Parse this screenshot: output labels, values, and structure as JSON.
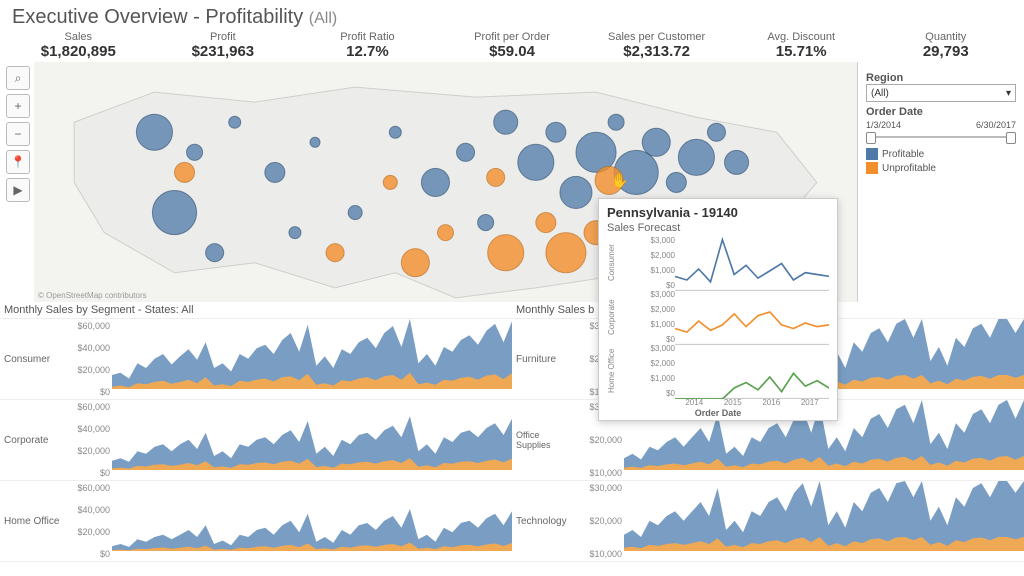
{
  "title_main": "Executive Overview - Profitability",
  "title_scope": "(All)",
  "kpis": [
    {
      "label": "Sales",
      "value": "$1,820,895"
    },
    {
      "label": "Profit",
      "value": "$231,963"
    },
    {
      "label": "Profit Ratio",
      "value": "12.7%"
    },
    {
      "label": "Profit per Order",
      "value": "$59.04"
    },
    {
      "label": "Sales per Customer",
      "value": "$2,313.72"
    },
    {
      "label": "Avg. Discount",
      "value": "15.71%"
    },
    {
      "label": "Quantity",
      "value": "29,793"
    }
  ],
  "map_attribution": "© OpenStreetMap contributors",
  "filters": {
    "region_label": "Region",
    "region_selected": "(All)",
    "date_label": "Order Date",
    "date_start": "1/3/2014",
    "date_end": "6/30/2017",
    "legend": [
      {
        "name": "Profitable",
        "color": "#4e79a7"
      },
      {
        "name": "Unprofitable",
        "color": "#f28e2b"
      }
    ]
  },
  "left_panel_title": "Monthly Sales by Segment - States: All",
  "right_panel_title": "Monthly Sales b",
  "segments": [
    "Consumer",
    "Corporate",
    "Home Office"
  ],
  "categories": [
    "Furniture",
    "Office Supplies",
    "Technology"
  ],
  "left_y_ticks": [
    "$60,000",
    "$40,000",
    "$20,000",
    "$0"
  ],
  "right_y_ticks": [
    "$30,000",
    "$20,000",
    "$10,000"
  ],
  "tooltip": {
    "header": "Pennsylvania - 19140",
    "sub": "Sales Forecast",
    "rows": [
      "Consumer",
      "Corporate",
      "Home Office"
    ],
    "y_ticks": [
      "$3,000",
      "$2,000",
      "$1,000",
      "$0"
    ],
    "x_ticks": [
      "2014",
      "2015",
      "2016",
      "2017"
    ],
    "x_label": "Order Date",
    "colors": [
      "#4e79a7",
      "#f28e2b",
      "#59a14f"
    ]
  },
  "chart_data": {
    "kpi_values": {
      "Sales": 1820895,
      "Profit": 231963,
      "Profit Ratio": 0.127,
      "Profit per Order": 59.04,
      "Sales per Customer": 2313.72,
      "Avg. Discount": 0.1571,
      "Quantity": 29793
    },
    "monthly_sales_by_segment": {
      "type": "area",
      "x_months": 48,
      "ylim": [
        0,
        60000
      ],
      "series": [
        {
          "name": "Consumer",
          "profitable": [
            12000,
            14000,
            9000,
            22000,
            18000,
            26000,
            30000,
            21000,
            28000,
            34000,
            25000,
            40000,
            18000,
            22000,
            15000,
            30000,
            26000,
            35000,
            38000,
            30000,
            42000,
            48000,
            32000,
            55000,
            20000,
            28000,
            18000,
            34000,
            30000,
            40000,
            44000,
            35000,
            48000,
            54000,
            36000,
            60000,
            22000,
            30000,
            20000,
            36000,
            32000,
            42000,
            46000,
            38000,
            50000,
            56000,
            40000,
            58000
          ],
          "unprofitable": [
            2000,
            3000,
            1500,
            5000,
            4000,
            6000,
            7000,
            4500,
            6000,
            8000,
            5000,
            10000,
            3000,
            4000,
            2500,
            7000,
            6000,
            8000,
            9000,
            6500,
            10000,
            11000,
            7500,
            13000,
            3500,
            5000,
            3000,
            7500,
            6500,
            9000,
            10000,
            7500,
            11000,
            12000,
            8000,
            14000,
            4000,
            5500,
            3500,
            8000,
            7000,
            9500,
            10500,
            8000,
            11500,
            12500,
            8500,
            13500
          ]
        },
        {
          "name": "Corporate",
          "profitable": [
            8000,
            10000,
            7000,
            16000,
            14000,
            20000,
            22000,
            16000,
            22000,
            26000,
            18000,
            32000,
            12000,
            16000,
            10000,
            22000,
            20000,
            26000,
            28000,
            22000,
            30000,
            34000,
            24000,
            42000,
            14000,
            20000,
            12000,
            26000,
            22000,
            30000,
            32000,
            26000,
            34000,
            38000,
            28000,
            46000,
            16000,
            22000,
            14000,
            28000,
            24000,
            32000,
            34000,
            28000,
            36000,
            40000,
            30000,
            44000
          ],
          "unprofitable": [
            1500,
            2000,
            1200,
            3500,
            3000,
            4500,
            5000,
            3500,
            4500,
            6000,
            4000,
            7500,
            2200,
            3000,
            1800,
            5000,
            4500,
            6000,
            6500,
            5000,
            7000,
            8000,
            5500,
            9500,
            2500,
            3500,
            2000,
            5500,
            5000,
            6500,
            7000,
            5500,
            7500,
            8500,
            6000,
            10000,
            2800,
            4000,
            2300,
            6000,
            5500,
            7000,
            7500,
            6000,
            8000,
            9000,
            6500,
            9800
          ]
        },
        {
          "name": "Home Office",
          "profitable": [
            4000,
            6000,
            3500,
            10000,
            8000,
            12000,
            14000,
            10000,
            14000,
            18000,
            12000,
            22000,
            6000,
            9000,
            5000,
            14000,
            12000,
            18000,
            20000,
            14000,
            22000,
            26000,
            16000,
            32000,
            8000,
            12000,
            7000,
            18000,
            14000,
            22000,
            24000,
            18000,
            26000,
            30000,
            20000,
            36000,
            10000,
            14000,
            8000,
            20000,
            16000,
            24000,
            26000,
            20000,
            28000,
            32000,
            22000,
            34000
          ],
          "unprofitable": [
            800,
            1200,
            700,
            2000,
            1600,
            2500,
            3000,
            2000,
            2800,
            3600,
            2400,
            4500,
            1200,
            1800,
            1000,
            2800,
            2400,
            3600,
            4000,
            2800,
            4400,
            5200,
            3200,
            6400,
            1600,
            2400,
            1400,
            3600,
            2800,
            4400,
            4800,
            3600,
            5200,
            6000,
            4000,
            7200,
            2000,
            2800,
            1600,
            4000,
            3200,
            4800,
            5200,
            4000,
            5600,
            6400,
            4400,
            6800
          ]
        }
      ]
    },
    "monthly_sales_by_category": {
      "type": "area",
      "x_months": 48,
      "ylim": [
        0,
        30000
      ],
      "series": [
        {
          "name": "Furniture",
          "profitable": [
            6000,
            8000,
            5000,
            12000,
            10000,
            14000,
            16000,
            12000,
            16000,
            20000,
            14000,
            26000,
            8000,
            12000,
            7000,
            16000,
            14000,
            20000,
            22000,
            16000,
            24000,
            28000,
            18000,
            30000,
            10000,
            16000,
            9000,
            20000,
            16000,
            24000,
            26000,
            20000,
            28000,
            30000,
            22000,
            30000,
            12000,
            18000,
            10000,
            22000,
            18000,
            26000,
            28000,
            22000,
            30000,
            30000,
            24000,
            30000
          ],
          "unprofitable": [
            1200,
            1600,
            1000,
            2400,
            2000,
            2800,
            3200,
            2400,
            3200,
            4000,
            2800,
            5200,
            1600,
            2400,
            1400,
            3200,
            2800,
            4000,
            4400,
            3200,
            4800,
            5600,
            3600,
            6000,
            2000,
            3200,
            1800,
            4000,
            3200,
            4800,
            5200,
            4000,
            5600,
            6000,
            4400,
            6000,
            2400,
            3600,
            2000,
            4400,
            3600,
            5200,
            5600,
            4400,
            6000,
            6000,
            4800,
            6000
          ]
        },
        {
          "name": "Office Supplies",
          "profitable": [
            5000,
            7000,
            4500,
            10000,
            8500,
            12000,
            14000,
            10000,
            14000,
            18000,
            12000,
            24000,
            7000,
            10000,
            6000,
            14000,
            12000,
            18000,
            20000,
            14000,
            22000,
            26000,
            16000,
            28000,
            9000,
            14000,
            8000,
            18000,
            14000,
            22000,
            24000,
            18000,
            26000,
            28000,
            20000,
            30000,
            11000,
            16000,
            9000,
            20000,
            16000,
            24000,
            26000,
            20000,
            28000,
            30000,
            22000,
            30000
          ],
          "unprofitable": [
            1000,
            1400,
            900,
            2000,
            1700,
            2400,
            2800,
            2000,
            2800,
            3600,
            2400,
            4800,
            1400,
            2000,
            1200,
            2800,
            2400,
            3600,
            4000,
            2800,
            4400,
            5200,
            3200,
            5600,
            1800,
            2800,
            1600,
            3600,
            2800,
            4400,
            4800,
            3600,
            5200,
            5600,
            4000,
            6000,
            2200,
            3200,
            1800,
            4000,
            3200,
            4800,
            5200,
            4000,
            5600,
            6000,
            4400,
            6000
          ]
        },
        {
          "name": "Technology",
          "profitable": [
            7000,
            9000,
            6000,
            13000,
            11000,
            15000,
            17000,
            13000,
            17000,
            21000,
            15000,
            27000,
            9000,
            13000,
            8000,
            17000,
            15000,
            21000,
            23000,
            17000,
            25000,
            29000,
            19000,
            30000,
            11000,
            17000,
            10000,
            21000,
            17000,
            25000,
            27000,
            21000,
            29000,
            30000,
            23000,
            30000,
            13000,
            19000,
            11000,
            23000,
            19000,
            27000,
            29000,
            23000,
            30000,
            30000,
            25000,
            30000
          ],
          "unprofitable": [
            1400,
            1800,
            1200,
            2600,
            2200,
            3000,
            3400,
            2600,
            3400,
            4200,
            3000,
            5400,
            1800,
            2600,
            1600,
            3400,
            3000,
            4200,
            4600,
            3400,
            5000,
            5800,
            3800,
            6000,
            2200,
            3400,
            2000,
            4200,
            3400,
            5000,
            5400,
            4200,
            5800,
            6000,
            4600,
            6000,
            2600,
            3800,
            2200,
            4600,
            3800,
            5400,
            5800,
            4600,
            6000,
            6000,
            5000,
            6000
          ]
        }
      ]
    },
    "tooltip_forecast": {
      "type": "line",
      "x": [
        "2014",
        "2015",
        "2016",
        "2017"
      ],
      "ylim": [
        0,
        3000
      ],
      "series": [
        {
          "name": "Consumer",
          "values": [
            800,
            600,
            1200,
            500,
            2800,
            900,
            1400,
            700,
            1100,
            1500,
            600,
            1000,
            900,
            800
          ]
        },
        {
          "name": "Corporate",
          "values": [
            900,
            700,
            1300,
            800,
            1100,
            1700,
            1000,
            1600,
            1800,
            1100,
            900,
            1200,
            1000,
            1100
          ]
        },
        {
          "name": "Home Office",
          "values": [
            0,
            0,
            0,
            0,
            0,
            600,
            900,
            500,
            1200,
            400,
            1400,
            700,
            1000,
            600
          ]
        }
      ]
    },
    "map": {
      "type": "bubble-map",
      "legend": {
        "Profitable": "#4e79a7",
        "Unprofitable": "#f28e2b"
      },
      "note": "Bubble size ≈ sales volume; color = profitable vs unprofitable by ZIP/region"
    }
  }
}
